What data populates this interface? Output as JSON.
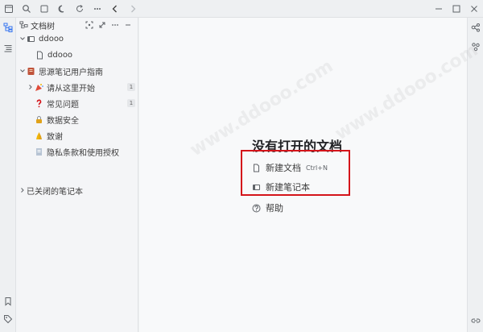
{
  "toolbar": {
    "icons": [
      "app-icon",
      "search-icon",
      "square-icon",
      "moon-icon",
      "sync-icon",
      "more-icon",
      "back-icon",
      "forward-icon"
    ],
    "window_icons": [
      "minimize-icon",
      "maximize-icon",
      "close-icon"
    ]
  },
  "panel": {
    "title": "文档树"
  },
  "tree": {
    "notebook1": {
      "label": "ddooo"
    },
    "notebook1_doc": {
      "label": "ddooo"
    },
    "notebook2": {
      "label": "思源笔记用户指南"
    },
    "items": [
      {
        "label": "请从这里开始",
        "count": "1"
      },
      {
        "label": "常见问题",
        "count": "1"
      },
      {
        "label": "数据安全"
      },
      {
        "label": "致谢"
      },
      {
        "label": "隐私条款和使用授权"
      }
    ],
    "closed": {
      "label": "已关闭的笔记本"
    }
  },
  "main": {
    "empty_title": "没有打开的文档",
    "new_doc": "新建文档",
    "new_doc_shortcut": "Ctrl+N",
    "new_notebook": "新建笔记本",
    "help": "帮助"
  },
  "colors": {
    "highlight": "#d4141a",
    "accent": "#3575f0"
  }
}
